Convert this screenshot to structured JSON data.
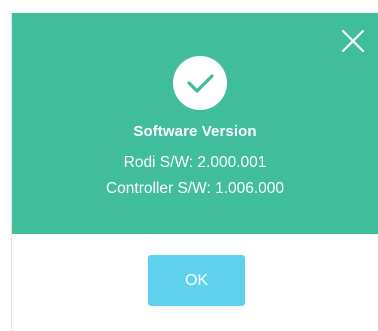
{
  "dialog": {
    "title": "Software Version",
    "lines": [
      "Rodi S/W: 2.000.001",
      "Controller S/W: 1.006.000"
    ],
    "ok_label": "OK",
    "icons": {
      "close": "close-icon",
      "status": "checkmark-icon"
    },
    "colors": {
      "header_bg": "#40bd9d",
      "ok_button_bg": "#5ed2ec",
      "text": "#ffffff"
    }
  }
}
